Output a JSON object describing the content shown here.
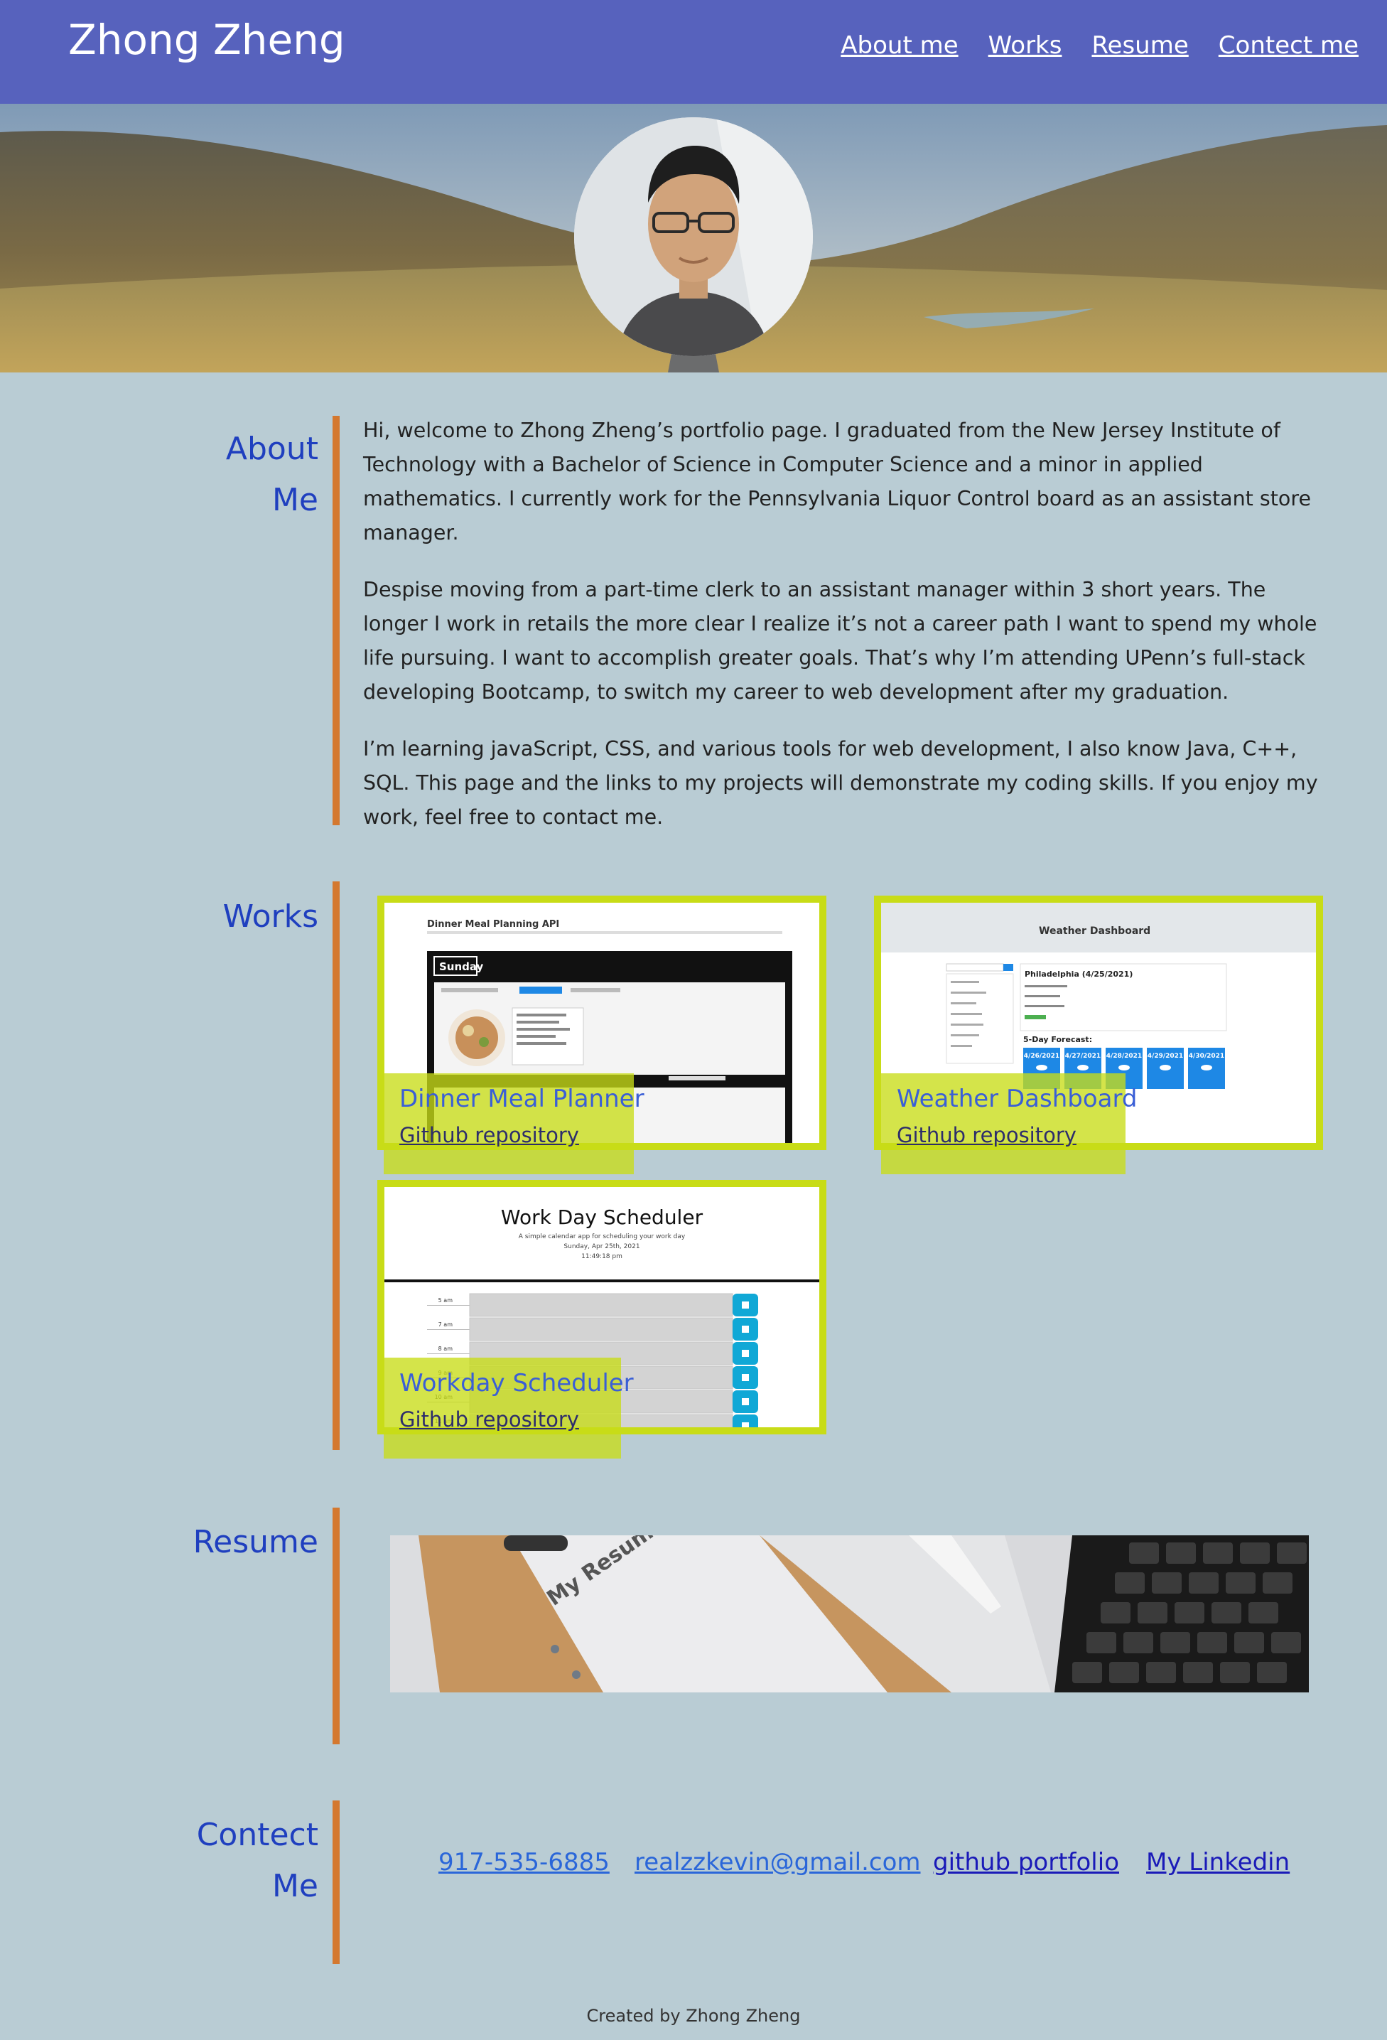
{
  "header": {
    "title": "Zhong Zheng",
    "nav": [
      "About me",
      "Works",
      "Resume",
      "Contect me"
    ]
  },
  "about": {
    "heading_line1": "About",
    "heading_line2": "Me",
    "paragraphs": [
      "Hi, welcome to Zhong Zheng’s portfolio page. I graduated from the New Jersey Institute of Technology with a Bachelor of Science in Computer Science and a minor in applied mathematics. I currently work for the Pennsylvania Liquor Control board as an assistant store manager.",
      "Despise moving from a part-time clerk to an assistant manager within 3 short years. The longer I work in retails the more clear I realize it’s not a career path I want to spend my whole life pursuing. I want to accomplish greater goals. That’s why I’m attending UPenn’s full-stack developing Bootcamp, to switch my career to web development after my graduation.",
      "I’m learning javaScript, CSS, and various tools for web development, I also know Java, C++, SQL. This page and the links to my projects will demonstrate my coding skills. If you enjoy my work, feel free to contact me."
    ]
  },
  "works": {
    "heading": "Works",
    "items": [
      {
        "title": "Dinner Meal Planner",
        "link": "Github repository",
        "shot_title": "Dinner Meal Planning API",
        "shot_day": "Sunday"
      },
      {
        "title": "Weather Dashboard",
        "link": "Github repository",
        "shot_title": "Weather Dashboard",
        "shot_city": "Philadelphia (4/25/2021)",
        "shot_forecast_label": "5-Day Forecast:",
        "shot_days": [
          "4/26/2021",
          "4/27/2021",
          "4/28/2021",
          "4/29/2021",
          "4/30/2021"
        ]
      },
      {
        "title": "Workday Scheduler",
        "link": "Github repository",
        "shot_title": "Work Day Scheduler",
        "shot_sub": "A simple calendar app for scheduling your work day",
        "shot_date": "Sunday, Apr 25th, 2021",
        "shot_time": "11:49:18 pm",
        "shot_hours": [
          "5 am",
          "7 am",
          "8 am",
          "9 am",
          "10 am",
          "11 am"
        ]
      }
    ]
  },
  "resume": {
    "heading": "Resume",
    "image_text": "My Resume"
  },
  "contact": {
    "heading_line1": "Contect",
    "heading_line2": "Me",
    "phone": "917-535-6885",
    "email": "realzzkevin@gmail.com",
    "github": "github portfolio",
    "linkedin": "My Linkedin"
  },
  "footer": "Created by Zhong Zheng",
  "colors": {
    "header_bg": "#5762bd",
    "page_bg": "#b9ccd4",
    "accent_bar": "#d4782f",
    "heading": "#1f3fbf",
    "card_border": "#c8dc17"
  }
}
